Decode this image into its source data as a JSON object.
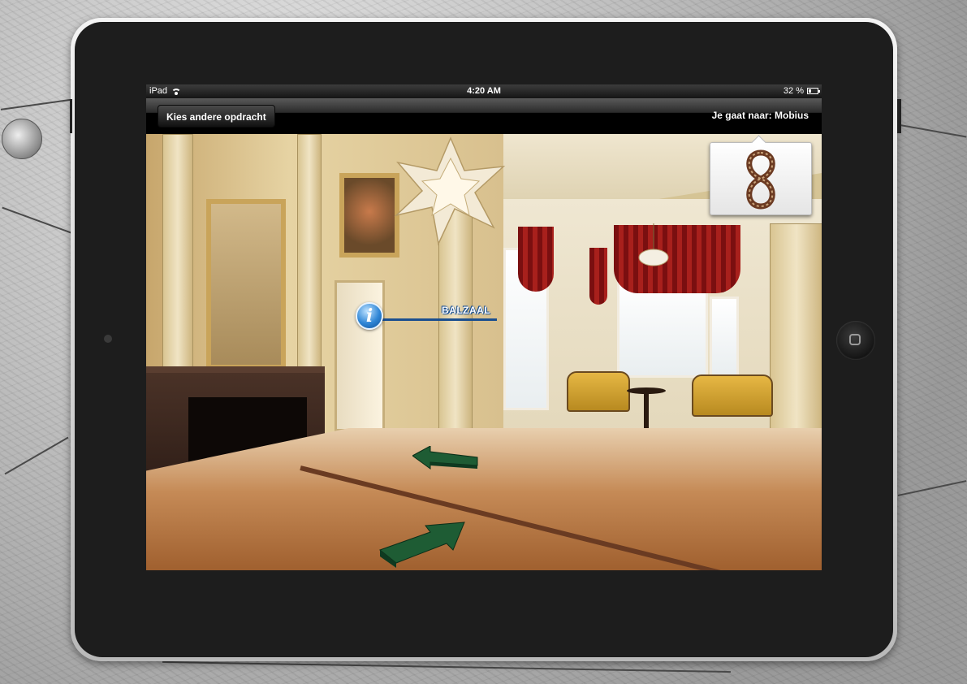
{
  "status_bar": {
    "device": "iPad",
    "time": "4:20 AM",
    "battery_text": "32 %",
    "battery_level": 0.32
  },
  "nav_bar": {
    "back_label": "Kies andere opdracht",
    "destination": "Je gaat naar: Mobius"
  },
  "scene": {
    "room_label": "BALZAAL",
    "info_glyph": "i"
  },
  "icons": {
    "wifi": "wifi-icon",
    "battery": "battery-icon",
    "info": "info-icon",
    "arrow_left": "green-arrow-left-icon",
    "arrow_forward": "green-arrow-forward-icon"
  },
  "colors": {
    "info_blue": "#2f86d6",
    "arrow_green": "#1e5c34",
    "bezel": "#1d1d1d"
  }
}
